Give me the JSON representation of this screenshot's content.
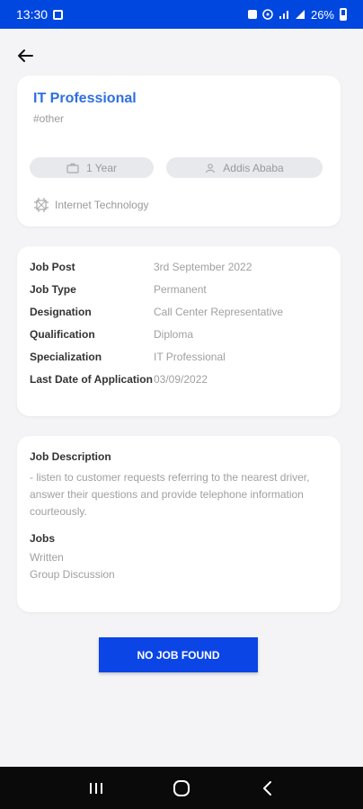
{
  "status_bar": {
    "time": "13:30",
    "battery": "26%"
  },
  "job": {
    "title": "IT Professional",
    "tag": "#other",
    "experience": "1 Year",
    "location": "Addis Ababa",
    "industry": "Internet Technology"
  },
  "details": [
    {
      "label": "Job Post",
      "value": "3rd  September 2022"
    },
    {
      "label": "Job Type",
      "value": "Permanent"
    },
    {
      "label": "Designation",
      "value": "Call Center Representative"
    },
    {
      "label": "Qualification",
      "value": "Diploma"
    },
    {
      "label": "Specialization",
      "value": "IT Professional"
    },
    {
      "label": "Last Date of Application",
      "value": "03/09/2022"
    }
  ],
  "description": {
    "heading": "Job Description",
    "text": "- listen to customer requests referring to the nearest driver, answer their questions and provide telephone information courteously.",
    "jobs_heading": "Jobs",
    "jobs": [
      "Written",
      "Group Discussion"
    ]
  },
  "cta_label": "NO JOB FOUND",
  "colors": {
    "accent": "#0b45e6",
    "title": "#2f6fe0",
    "status_bar": "#0047e0"
  }
}
